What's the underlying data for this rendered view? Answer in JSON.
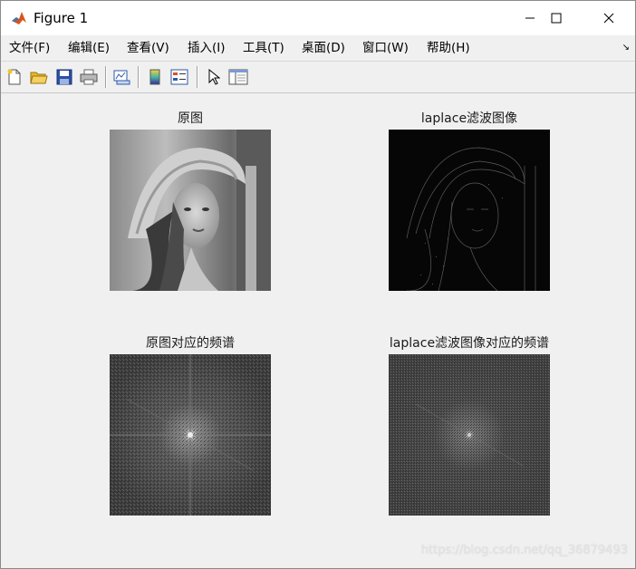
{
  "window": {
    "title": "Figure 1",
    "minimize_glyph": "─",
    "maximize_glyph": "☐",
    "close_glyph": "✕"
  },
  "menu": {
    "items": [
      {
        "label": "文件(F)"
      },
      {
        "label": "编辑(E)"
      },
      {
        "label": "查看(V)"
      },
      {
        "label": "插入(I)"
      },
      {
        "label": "工具(T)"
      },
      {
        "label": "桌面(D)"
      },
      {
        "label": "窗口(W)"
      },
      {
        "label": "帮助(H)"
      }
    ],
    "dock_arrow": "↘"
  },
  "toolbar": {
    "icons": [
      "new-figure-icon",
      "open-file-icon",
      "save-icon",
      "print-icon",
      "link-plot-icon",
      "colorbar-icon",
      "legend-icon",
      "pointer-icon",
      "property-inspector-icon"
    ]
  },
  "plots": {
    "original": {
      "title": "原图"
    },
    "laplace": {
      "title": "laplace滤波图像"
    },
    "original_spectrum": {
      "title": "原图对应的频谱"
    },
    "laplace_spectrum": {
      "title": "laplace滤波图像对应的频谱"
    }
  },
  "watermark": "https://blog.csdn.net/qq_36879493",
  "colors": {
    "matlab_orange": "#d9541a",
    "window_bg": "#f0f0f0"
  }
}
